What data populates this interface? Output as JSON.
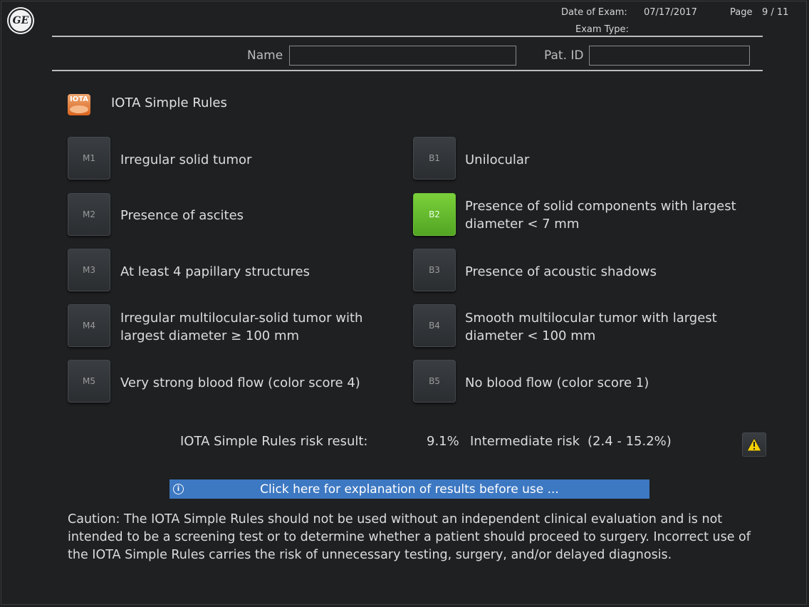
{
  "header": {
    "logo_text": "GE",
    "date_of_exam_label": "Date of Exam:",
    "date_of_exam_value": "07/17/2017",
    "page_label": "Page",
    "page_value": "9 / 11",
    "exam_type_label": "Exam Type:"
  },
  "patient": {
    "name_label": "Name",
    "name_value": "",
    "pat_id_label": "Pat. ID",
    "pat_id_value": ""
  },
  "section": {
    "icon_text": "IOTA",
    "title": "IOTA Simple Rules"
  },
  "malignant_rules": [
    {
      "code": "M1",
      "text": "Irregular solid tumor",
      "selected": false
    },
    {
      "code": "M2",
      "text": "Presence of ascites",
      "selected": false
    },
    {
      "code": "M3",
      "text": "At least 4 papillary structures",
      "selected": false
    },
    {
      "code": "M4",
      "text": "Irregular multilocular-solid tumor with largest diameter ≥ 100 mm",
      "selected": false
    },
    {
      "code": "M5",
      "text": "Very strong blood flow (color score 4)",
      "selected": false
    }
  ],
  "benign_rules": [
    {
      "code": "B1",
      "text": "Unilocular",
      "selected": false
    },
    {
      "code": "B2",
      "text": "Presence of solid components with largest diameter < 7 mm",
      "selected": true
    },
    {
      "code": "B3",
      "text": "Presence of acoustic shadows",
      "selected": false
    },
    {
      "code": "B4",
      "text": "Smooth multilocular tumor with largest diameter < 100 mm",
      "selected": false
    },
    {
      "code": "B5",
      "text": "No blood flow (color score 1)",
      "selected": false
    }
  ],
  "risk": {
    "label": "IOTA Simple Rules risk result:",
    "percent": "9.1%",
    "category": "Intermediate risk",
    "range": "(2.4 - 15.2%)"
  },
  "explain_button": {
    "label": "Click here for explanation of results before use ..."
  },
  "caution": "Caution: The IOTA Simple Rules should not be used without an independent clinical evaluation and is not intended to be a screening test or to determine whether a patient should proceed to surgery. Incorrect use of the IOTA Simple Rules carries the risk of unnecessary testing, surgery, and/or delayed diagnosis.",
  "colors": {
    "background": "#1e2022",
    "selected_green": "#66bb2e",
    "explain_blue": "#3d78c2",
    "warning_yellow": "#f5d000"
  }
}
